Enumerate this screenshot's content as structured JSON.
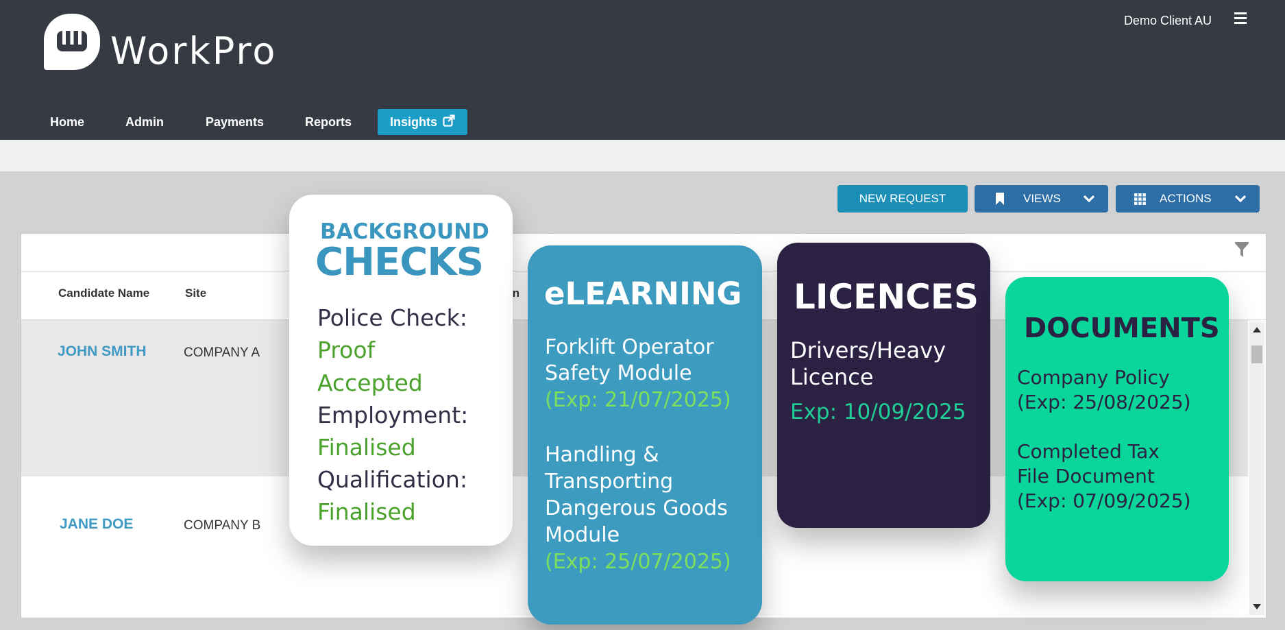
{
  "header": {
    "logo_text": "WorkPro",
    "client_name": "Demo Client AU"
  },
  "nav": {
    "items": [
      "Home",
      "Admin",
      "Payments",
      "Reports",
      "Insights"
    ]
  },
  "toolbar": {
    "new_request": "NEW REQUEST",
    "views": "VIEWS",
    "actions": "ACTIONS"
  },
  "grid": {
    "columns": [
      "Candidate Name",
      "Site"
    ],
    "partial_column": "rn",
    "rows": [
      {
        "candidate": "JOHN SMITH",
        "site": "COMPANY A"
      },
      {
        "candidate": "JANE DOE",
        "site": "COMPANY B"
      }
    ]
  },
  "cards": {
    "background_checks": {
      "title_top": "BACKGROUND",
      "title_main": "CHECKS",
      "police_label": "Police Check:",
      "police_value_1": "Proof",
      "police_value_2": "Accepted",
      "employment_label": "Employment:",
      "employment_value": "Finalised",
      "qualification_label": "Qualification:",
      "qualification_value": "Finalised"
    },
    "elearning": {
      "title": "eLEARNING",
      "m1_line1": "Forklift Operator",
      "m1_line2": "Safety Module",
      "m1_exp": "(Exp: 21/07/2025)",
      "m2_line1": "Handling &",
      "m2_line2": "Transporting",
      "m2_line3": "Dangerous Goods",
      "m2_line4": "Module",
      "m2_exp": "(Exp: 25/07/2025)"
    },
    "licences": {
      "title": "LICENCES",
      "line1": "Drivers/Heavy",
      "line2": "Licence",
      "exp": "Exp: 10/09/2025"
    },
    "documents": {
      "title": "DOCUMENTS",
      "d1_line1": "Company Policy",
      "d1_line2": "(Exp: 25/08/2025)",
      "d2_line1": "Completed Tax",
      "d2_line2": "File Document",
      "d2_line3": "(Exp: 07/09/2025)"
    }
  },
  "colors": {
    "header_bg": "#363a42",
    "accent_blue": "#1c9dc6",
    "dark_blue_button": "#2c6ea5",
    "link_blue": "#3e9ac4",
    "green_text": "#4aa12b",
    "elearning_bg": "#3d9bbf",
    "licences_bg": "#2b2142",
    "documents_bg": "#0ad69c"
  },
  "icons": [
    "workpro-logo-icon",
    "hamburger-menu-icon",
    "external-link-icon",
    "bookmark-icon",
    "chevron-down-icon",
    "grid-icon",
    "filter-icon"
  ]
}
